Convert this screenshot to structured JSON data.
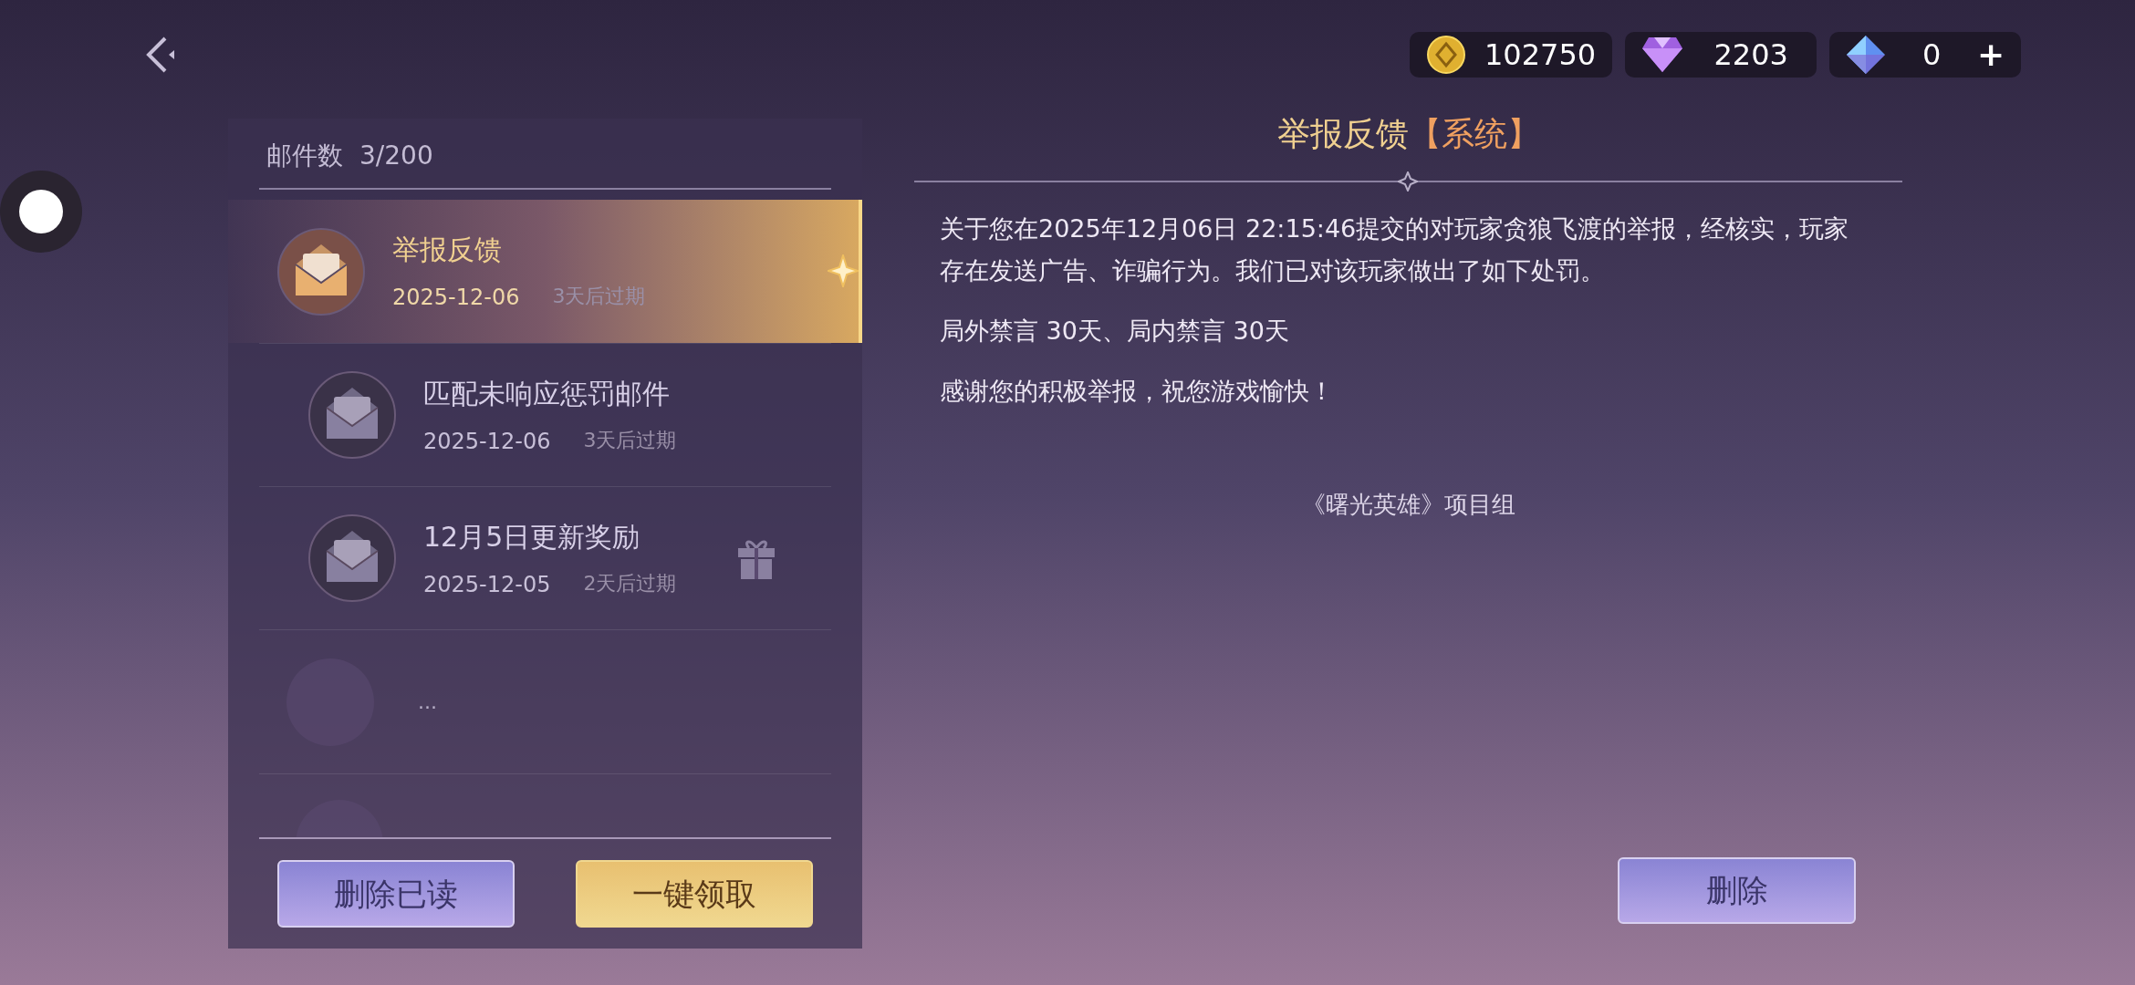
{
  "currencies": [
    {
      "kind": "coin",
      "amount": "102750"
    },
    {
      "kind": "gem",
      "amount": "2203"
    },
    {
      "kind": "crystal",
      "amount": "0",
      "plus": "+"
    }
  ],
  "mail_list": {
    "count_label": "邮件数",
    "count": "3/200",
    "items": [
      {
        "kind": "mail",
        "title": "举报反馈",
        "date": "2025-12-06",
        "expiry": "3天后过期",
        "selected": true,
        "gift": false
      },
      {
        "kind": "mail",
        "title": "匹配未响应惩罚邮件",
        "date": "2025-12-06",
        "expiry": "3天后过期",
        "selected": false,
        "gift": false
      },
      {
        "kind": "mail",
        "title": "12月5日更新奖励",
        "date": "2025-12-05",
        "expiry": "2天后过期",
        "selected": false,
        "gift": true
      },
      {
        "kind": "placeholder",
        "text": "..."
      }
    ],
    "buttons": [
      "删除已读",
      "一键领取"
    ]
  },
  "mail_detail": {
    "title": "举报反馈",
    "tag": "【系统】",
    "paragraphs": [
      "关于您在2025年12月06日 22:15:46提交的对玩家贪狼飞渡的举报，经核实，玩家存在发送广告、诈骗行为。我们已对该玩家做出了如下处罚。",
      "局外禁言 30天、局内禁言 30天",
      "感谢您的积极举报，祝您游戏愉快！"
    ],
    "signature": "《曙光英雄》项目组",
    "delete_button": "删除"
  }
}
